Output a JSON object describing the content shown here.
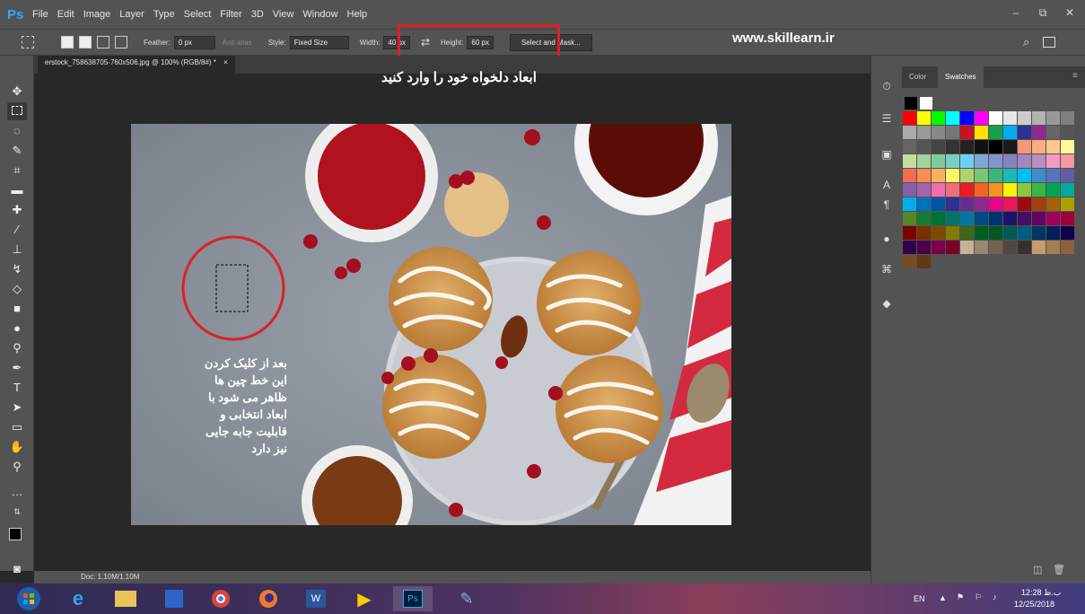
{
  "app": {
    "logo": "Ps",
    "menu": [
      "File",
      "Edit",
      "Image",
      "Layer",
      "Type",
      "Select",
      "Filter",
      "3D",
      "View",
      "Window",
      "Help"
    ],
    "window_controls": [
      "–",
      "⧉",
      "✕"
    ]
  },
  "options_bar": {
    "feather_label": "Feather:",
    "feather_value": "0 px",
    "antialias_label": "Anti-alias",
    "style_label": "Style:",
    "style_value": "Fixed Size",
    "width_label": "Width:",
    "width_value": "40 px",
    "swap_icon": "⇄",
    "height_label": "Height:",
    "height_value": "60 px",
    "select_mask_label": "Select and Mask..."
  },
  "overlay": {
    "site": "www.skillearn.ir",
    "title": "ابعاد دلخواه خود را وارد کنید",
    "note": [
      "بعد از کلیک کردن",
      "این خط چین ها",
      "ظاهر می شود با",
      "ابعاد انتخابی و",
      "قابلیت جابه جایی",
      "نیز دارد"
    ]
  },
  "document": {
    "tab_title": "erstock_758638705-760x506.jpg @ 100% (RGB/8#) *",
    "tab_close": "×",
    "status": "Doc: 1.10M/1.10M"
  },
  "panels": {
    "tabs": [
      "Color",
      "Swatches"
    ],
    "active_tab": "Swatches"
  },
  "taskbar": {
    "language": "EN",
    "time": "12:28 ب.ظ",
    "date": "12/25/2018"
  },
  "colors": {
    "accent": "#31a8ff",
    "annotation_red": "#e01f27"
  }
}
